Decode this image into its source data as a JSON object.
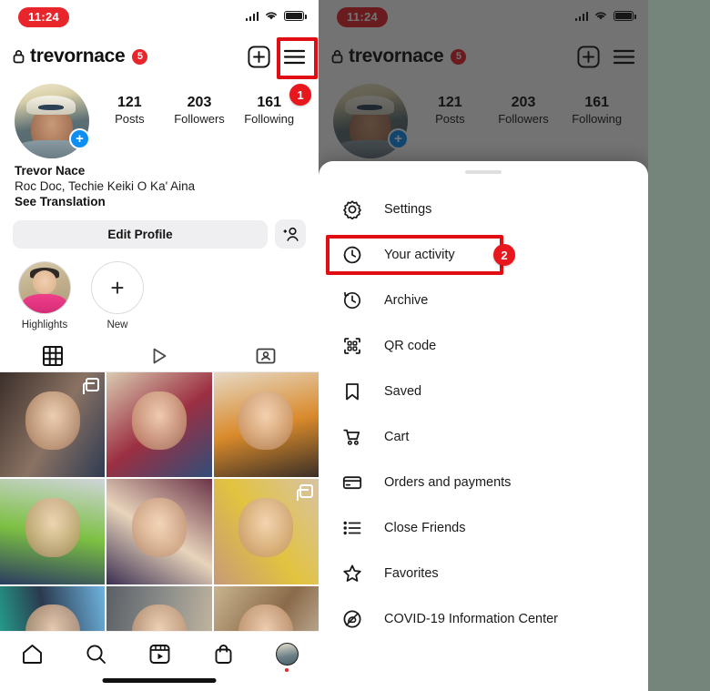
{
  "meta": {
    "accent_red": "#e8252a",
    "annotation_red": "#e00d12",
    "link_blue": "#0f8ef2",
    "backdrop": "#76857c"
  },
  "status_bar": {
    "time": "11:24",
    "signal_icon": "cellular-signal-icon",
    "wifi_icon": "wifi-icon",
    "battery_icon": "battery-icon"
  },
  "profile": {
    "lock_icon": "lock-icon",
    "username": "trevornace",
    "notification_count": "5",
    "add_icon": "plus-square-icon",
    "menu_icon": "hamburger-menu-icon",
    "avatar_alt": "profile-avatar",
    "story_add_icon": "plus-icon",
    "stats": [
      {
        "number": "121",
        "label": "Posts"
      },
      {
        "number": "203",
        "label": "Followers"
      },
      {
        "number": "161",
        "label": "Following"
      }
    ],
    "full_name": "Trevor Nace",
    "bio": "Roc Doc, Techie  Keiki O Ka' Aina",
    "translate_label": "See Translation",
    "edit_profile_label": "Edit Profile",
    "add_person_icon": "add-person-icon"
  },
  "highlights": [
    {
      "label": "Highlights",
      "kind": "photo"
    },
    {
      "label": "New",
      "kind": "plus"
    }
  ],
  "tabs": [
    {
      "name": "grid-tab",
      "icon": "grid-icon",
      "active": true
    },
    {
      "name": "reels-tab",
      "icon": "play-icon",
      "active": false
    },
    {
      "name": "tagged-tab",
      "icon": "tagged-person-icon",
      "active": false
    }
  ],
  "grid": {
    "cells": [
      {
        "id": "post-1",
        "multi": true,
        "c1": "#3b2f2a",
        "c2": "#8a7263",
        "c3": "#2f3b52"
      },
      {
        "id": "post-2",
        "multi": false,
        "c1": "#d9cbb0",
        "c2": "#9c2f42",
        "c3": "#2f4e7a"
      },
      {
        "id": "post-3",
        "multi": false,
        "c1": "#e6d8c4",
        "c2": "#d98a2b",
        "c3": "#3a2f26"
      },
      {
        "id": "post-4",
        "multi": false,
        "c1": "#cfd5d8",
        "c2": "#7cc042",
        "c3": "#2b3c61"
      },
      {
        "id": "post-5",
        "multi": false,
        "c1": "#6b3448",
        "c2": "#e8d4bb",
        "c3": "#3c2f52"
      },
      {
        "id": "post-6",
        "multi": true,
        "c1": "#d8c3a3",
        "c2": "#e2c33f",
        "c3": "#c79a78"
      },
      {
        "id": "post-7",
        "multi": false,
        "c1": "#6fb4e0",
        "c2": "#2a3a4e",
        "c3": "#23b39a"
      },
      {
        "id": "post-8",
        "multi": false,
        "c1": "#cbbba2",
        "c2": "#8b8d8a",
        "c3": "#5a5f66"
      },
      {
        "id": "post-9",
        "multi": false,
        "c1": "#ddd2bd",
        "c2": "#8a6a4a",
        "c3": "#c9b48f"
      }
    ]
  },
  "bottom_nav": [
    {
      "name": "nav-home",
      "icon": "home-icon"
    },
    {
      "name": "nav-search",
      "icon": "search-icon"
    },
    {
      "name": "nav-reels",
      "icon": "reels-icon"
    },
    {
      "name": "nav-shop",
      "icon": "shop-bag-icon"
    },
    {
      "name": "nav-profile",
      "icon": "profile-avatar-icon"
    }
  ],
  "menu_sheet": {
    "handle": "drag-handle",
    "items": [
      {
        "label": "Settings",
        "icon": "settings-gear-icon"
      },
      {
        "label": "Your activity",
        "icon": "activity-clock-icon"
      },
      {
        "label": "Archive",
        "icon": "archive-clock-icon"
      },
      {
        "label": "QR code",
        "icon": "qr-code-icon"
      },
      {
        "label": "Saved",
        "icon": "bookmark-icon"
      },
      {
        "label": "Cart",
        "icon": "shopping-cart-icon"
      },
      {
        "label": "Orders and payments",
        "icon": "credit-card-icon"
      },
      {
        "label": "Close Friends",
        "icon": "list-icon"
      },
      {
        "label": "Favorites",
        "icon": "star-icon"
      },
      {
        "label": "COVID-19 Information Center",
        "icon": "covid-info-icon"
      }
    ]
  },
  "annotations": [
    {
      "number": "1",
      "target": "hamburger-menu-icon"
    },
    {
      "number": "2",
      "target": "your-activity-menu-item"
    }
  ]
}
